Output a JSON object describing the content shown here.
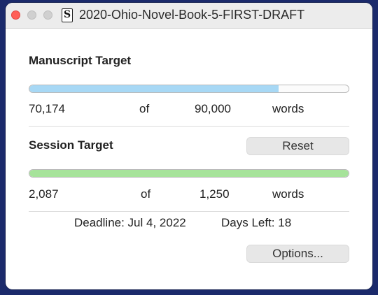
{
  "window": {
    "title": "2020-Ohio-Novel-Book-5-FIRST-DRAFT",
    "app_icon_glyph": "S"
  },
  "manuscript": {
    "heading": "Manuscript Target",
    "current": "70,174",
    "of_label": "of",
    "target": "90,000",
    "unit": "words",
    "progress_fraction": 0.78,
    "bar_color": "#a7d8f5"
  },
  "session": {
    "heading": "Session Target",
    "reset_label": "Reset",
    "current": "2,087",
    "of_label": "of",
    "target": "1,250",
    "unit": "words",
    "progress_fraction": 1.0,
    "bar_color": "#a6e39a"
  },
  "deadline": {
    "label": "Deadline: Jul 4, 2022",
    "days_left": "Days Left: 18"
  },
  "footer": {
    "options_label": "Options..."
  },
  "colors": {
    "desktop_background": "#1b2a6b",
    "close_button": "#ff5f57"
  }
}
